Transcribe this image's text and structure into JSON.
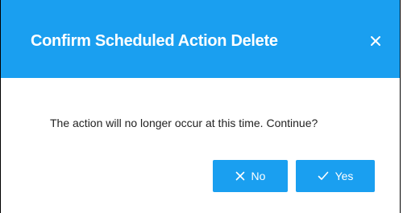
{
  "dialog": {
    "title": "Confirm Scheduled Action Delete",
    "message": "The action will no longer occur at this time. Continue?",
    "close_icon": "close-icon",
    "buttons": {
      "no_label": "No",
      "no_icon": "x-icon",
      "yes_label": "Yes",
      "yes_icon": "check-icon"
    }
  },
  "colors": {
    "accent": "#1a9ff0",
    "text": "#222222",
    "header_text": "#ffffff"
  }
}
